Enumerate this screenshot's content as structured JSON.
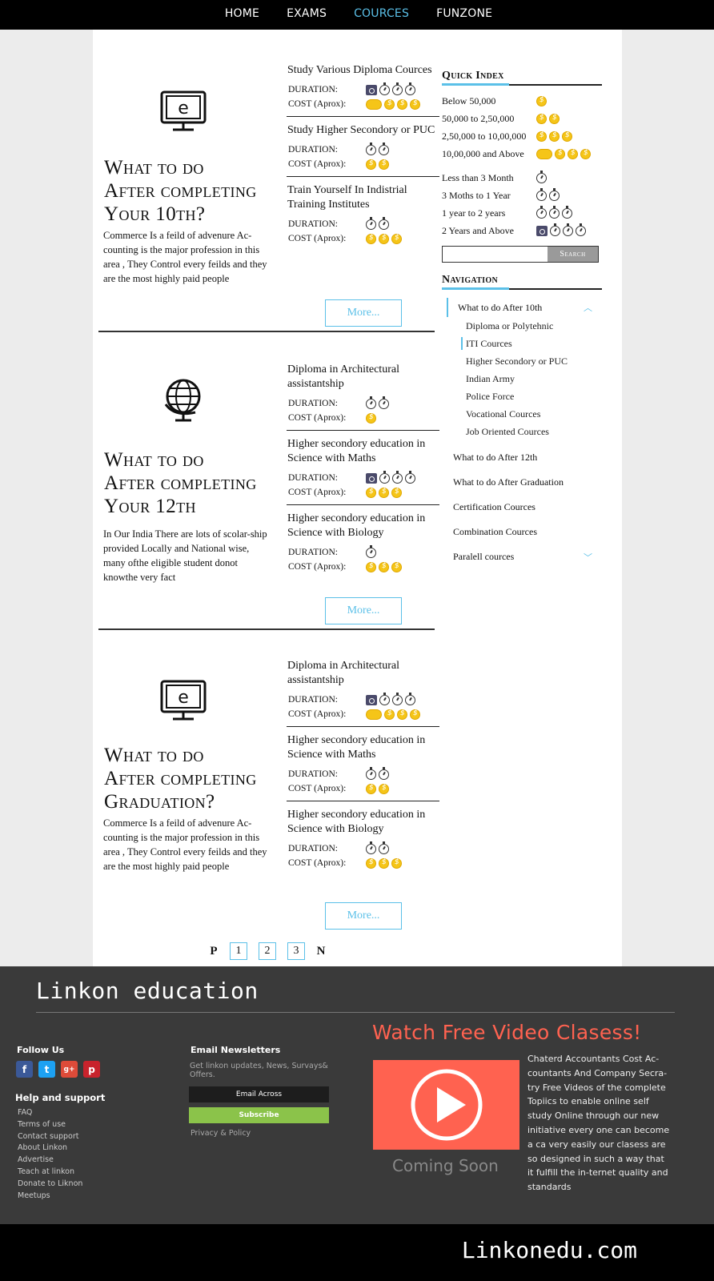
{
  "nav": {
    "items": [
      "HOME",
      "EXAMS",
      "COURCES",
      "FUNZONE"
    ],
    "active": "COURCES"
  },
  "sections": [
    {
      "icon": "e-learning-monitor-icon",
      "title_lines": [
        "What to do",
        "After completing",
        "Your 10th?"
      ],
      "description": "Commerce Is a feild of advenure Ac-counting is the major profession in this area , They Control every feilds and they are the most highly paid people",
      "more": "More...",
      "courses": [
        {
          "title": "Study Various Diploma Cources",
          "duration": "DURATION:",
          "cost_label": "COST (Aprox):",
          "duration_level": 4,
          "cost_level": 4
        },
        {
          "title": "Study Higher Secondory or PUC",
          "duration": "DURATION:",
          "cost_label": "COST (Aprox):",
          "duration_level": 2,
          "cost_level": 2
        },
        {
          "title": "Train Yourself In Indistrial Training Institutes",
          "duration": "DURATION:",
          "cost_label": "COST (Aprox):",
          "duration_level": 2,
          "cost_level": 3
        }
      ]
    },
    {
      "icon": "globe-icon",
      "title_lines": [
        "What to do",
        "After completing",
        "Your 12th"
      ],
      "description": "In Our India There are lots of scolar-ship provided Locally and National wise, many ofthe eligible student donot knowthe very fact",
      "more": "More...",
      "courses": [
        {
          "title": "Diploma in Architectural assistantship",
          "duration": "DURATION:",
          "cost_label": "COST (Aprox):",
          "duration_level": 2,
          "cost_level": 1
        },
        {
          "title": "Higher secondory education in Science with Maths",
          "duration": "DURATION:",
          "cost_label": "COST (Aprox):",
          "duration_level": 4,
          "cost_level": 3
        },
        {
          "title": "Higher secondory education in Science with Biology",
          "duration": "DURATION:",
          "cost_label": "COST (Aprox):",
          "duration_level": 1,
          "cost_level": 3
        }
      ]
    },
    {
      "icon": "e-learning-monitor-icon",
      "title_lines": [
        "What to do",
        "After completing",
        "Graduation?"
      ],
      "description": "Commerce Is a feild of advenure Ac-counting is the major profession in this area , They Control every feilds and they are the most highly paid people",
      "more": "More...",
      "courses": [
        {
          "title": "Diploma in Architectural assistantship",
          "duration": "DURATION:",
          "cost_label": "COST (Aprox):",
          "duration_level": 4,
          "cost_level": 4
        },
        {
          "title": "Higher secondory education in Science with Maths",
          "duration": "DURATION:",
          "cost_label": "COST (Aprox):",
          "duration_level": 2,
          "cost_level": 2
        },
        {
          "title": "Higher secondory education in Science with Biology",
          "duration": "DURATION:",
          "cost_label": "COST (Aprox):",
          "duration_level": 2,
          "cost_level": 3
        }
      ]
    }
  ],
  "quick_index": {
    "title": "Quick Index",
    "cost": [
      {
        "label": "Below 50,000",
        "level": 1
      },
      {
        "label": "50,000 to 2,50,000",
        "level": 2
      },
      {
        "label": "2,50,000 to 10,00,000",
        "level": 3
      },
      {
        "label": "10,00,000 and Above",
        "level": 4
      }
    ],
    "duration": [
      {
        "label": "Less than 3 Month",
        "level": 1
      },
      {
        "label": "3 Moths to 1 Year",
        "level": 2
      },
      {
        "label": "1 year to 2 years",
        "level": 3
      },
      {
        "label": "2 Years and Above",
        "level": 4
      }
    ],
    "search_button": "Search",
    "search_placeholder": ""
  },
  "navigation": {
    "title": "Navigation",
    "active_parent": "What to do After 10th",
    "sub_items": [
      "Diploma or Polytehnic",
      "ITI Cources",
      "Higher Secondory or PUC",
      "Indian Army",
      "Police Force",
      "Vocational Cources",
      "Job Oriented Cources"
    ],
    "active_sub": "ITI Cources",
    "items": [
      "What to do After 12th",
      "What to do After Graduation",
      "Certification Cources",
      "Combination Cources",
      "Paralell cources"
    ]
  },
  "pagination": {
    "prev": "P",
    "pages": [
      "1",
      "2",
      "3"
    ],
    "next": "N"
  },
  "footer": {
    "brand": "Linkon education",
    "follow_us": "Follow Us",
    "social": [
      "f",
      "t",
      "g+",
      "p"
    ],
    "help_title": "Help and support",
    "help_links": [
      "FAQ",
      "Terms of use",
      "Contact support",
      "About Linkon",
      "Advertise",
      "Teach at linkon",
      "Donate to Liknon",
      "Meetups"
    ],
    "newsletter_title": "Email Newsletters",
    "newsletter_desc": "Get linkon updates, News, Survays& Offers.",
    "email_placeholder": "Email Across",
    "subscribe": "Subscribe",
    "privacy": "Privacy & Policy",
    "video_title": "Watch Free Video Clasess!",
    "coming_soon": "Coming Soon",
    "video_desc": "Chaterd Accountants Cost Ac-countants And Company Secra-try Free Videos of the complete Topiics to enable online self study Online through our new initiative every one can become a ca very easily our clasess are so designed in such a way that it fulfill the in-ternet quality and standards",
    "site": "Linkonedu.com"
  },
  "colors": {
    "accent": "#5bc0e8",
    "video": "#ff6250",
    "coin": "#f5c518",
    "footer_bg": "#3a3a3a"
  }
}
